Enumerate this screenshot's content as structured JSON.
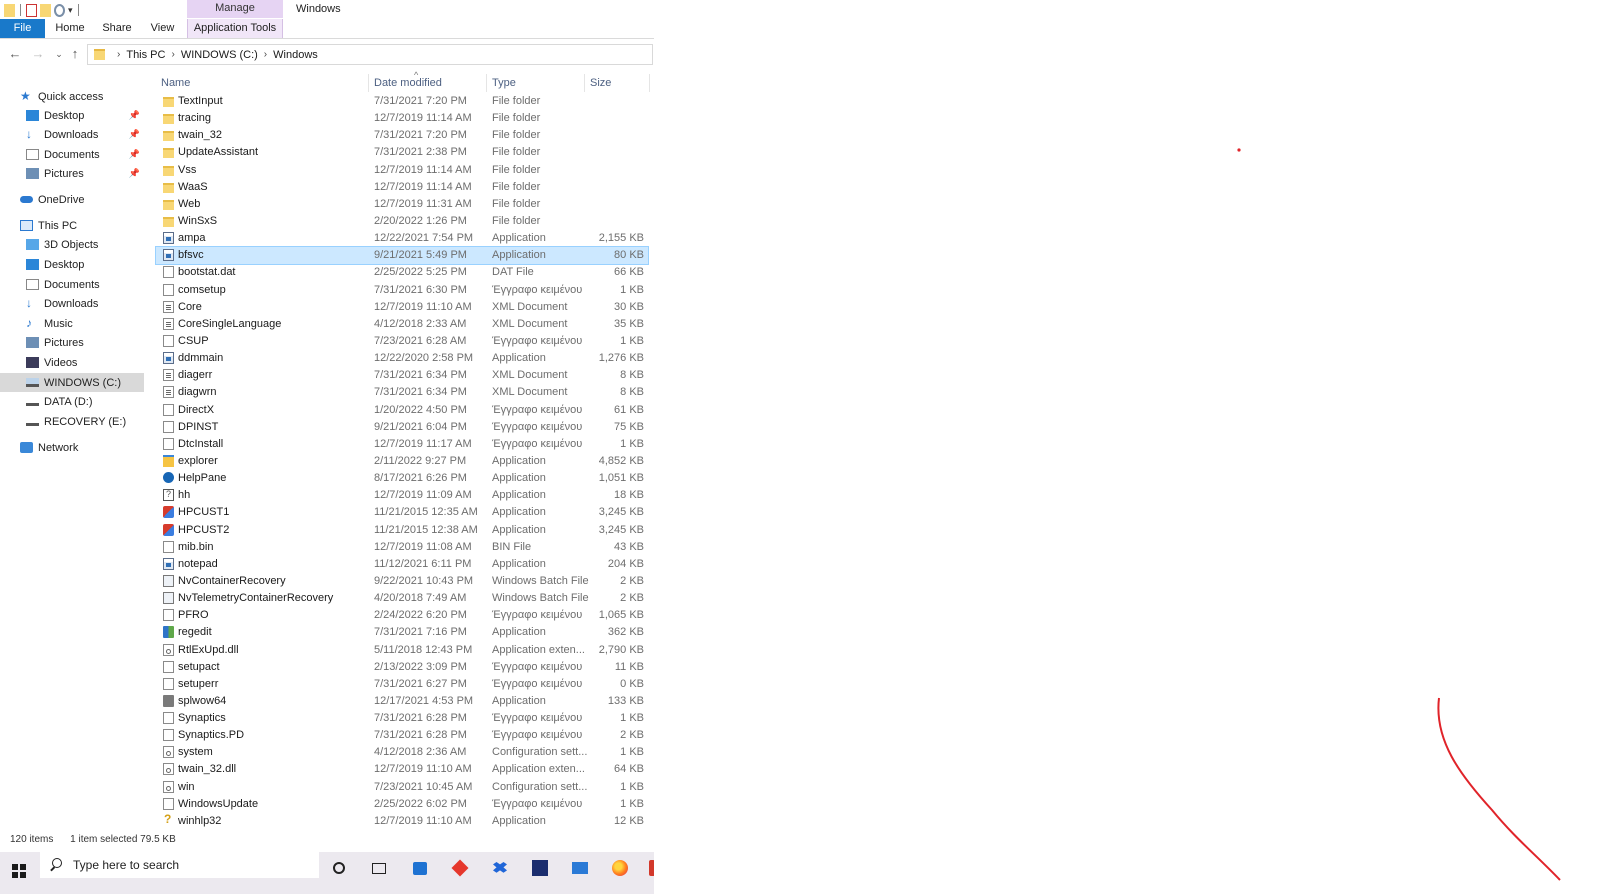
{
  "window": {
    "title": "Windows",
    "manage_tab": "Manage",
    "ribbon_tabs": [
      "File",
      "Home",
      "Share",
      "View",
      "Application Tools"
    ]
  },
  "address": {
    "path": [
      "This PC",
      "WINDOWS (C:)",
      "Windows"
    ]
  },
  "nav": {
    "quick_access": "Quick access",
    "quick_items": [
      "Desktop",
      "Downloads",
      "Documents",
      "Pictures"
    ],
    "onedrive": "OneDrive",
    "this_pc": "This PC",
    "pc_items": [
      "3D Objects",
      "Desktop",
      "Documents",
      "Downloads",
      "Music",
      "Pictures",
      "Videos",
      "WINDOWS (C:)",
      "DATA (D:)",
      "RECOVERY (E:)"
    ],
    "network": "Network"
  },
  "columns": {
    "name": "Name",
    "date": "Date modified",
    "type": "Type",
    "size": "Size"
  },
  "files": [
    {
      "name": "TextInput",
      "date": "7/31/2021 7:20 PM",
      "type": "File folder",
      "size": "",
      "icon": "folder"
    },
    {
      "name": "tracing",
      "date": "12/7/2019 11:14 AM",
      "type": "File folder",
      "size": "",
      "icon": "folder"
    },
    {
      "name": "twain_32",
      "date": "7/31/2021 7:20 PM",
      "type": "File folder",
      "size": "",
      "icon": "folder"
    },
    {
      "name": "UpdateAssistant",
      "date": "7/31/2021 2:38 PM",
      "type": "File folder",
      "size": "",
      "icon": "folder"
    },
    {
      "name": "Vss",
      "date": "12/7/2019 11:14 AM",
      "type": "File folder",
      "size": "",
      "icon": "folder"
    },
    {
      "name": "WaaS",
      "date": "12/7/2019 11:14 AM",
      "type": "File folder",
      "size": "",
      "icon": "folder"
    },
    {
      "name": "Web",
      "date": "12/7/2019 11:31 AM",
      "type": "File folder",
      "size": "",
      "icon": "folder"
    },
    {
      "name": "WinSxS",
      "date": "2/20/2022 1:26 PM",
      "type": "File folder",
      "size": "",
      "icon": "folder"
    },
    {
      "name": "ampa",
      "date": "12/22/2021 7:54 PM",
      "type": "Application",
      "size": "2,155 KB",
      "icon": "app"
    },
    {
      "name": "bfsvc",
      "date": "9/21/2021 5:49 PM",
      "type": "Application",
      "size": "80 KB",
      "icon": "app",
      "selected": true
    },
    {
      "name": "bootstat.dat",
      "date": "2/25/2022 5:25 PM",
      "type": "DAT File",
      "size": "66 KB",
      "icon": "doc"
    },
    {
      "name": "comsetup",
      "date": "7/31/2021 6:30 PM",
      "type": "Έγγραφο κειμένου",
      "size": "1 KB",
      "icon": "doc"
    },
    {
      "name": "Core",
      "date": "12/7/2019 11:10 AM",
      "type": "XML Document",
      "size": "30 KB",
      "icon": "xml"
    },
    {
      "name": "CoreSingleLanguage",
      "date": "4/12/2018 2:33 AM",
      "type": "XML Document",
      "size": "35 KB",
      "icon": "xml"
    },
    {
      "name": "CSUP",
      "date": "7/23/2021 6:28 AM",
      "type": "Έγγραφο κειμένου",
      "size": "1 KB",
      "icon": "doc"
    },
    {
      "name": "ddmmain",
      "date": "12/22/2020 2:58 PM",
      "type": "Application",
      "size": "1,276 KB",
      "icon": "app"
    },
    {
      "name": "diagerr",
      "date": "7/31/2021 6:34 PM",
      "type": "XML Document",
      "size": "8 KB",
      "icon": "xml"
    },
    {
      "name": "diagwrn",
      "date": "7/31/2021 6:34 PM",
      "type": "XML Document",
      "size": "8 KB",
      "icon": "xml"
    },
    {
      "name": "DirectX",
      "date": "1/20/2022 4:50 PM",
      "type": "Έγγραφο κειμένου",
      "size": "61 KB",
      "icon": "doc"
    },
    {
      "name": "DPINST",
      "date": "9/21/2021 6:04 PM",
      "type": "Έγγραφο κειμένου",
      "size": "75 KB",
      "icon": "doc"
    },
    {
      "name": "DtcInstall",
      "date": "12/7/2019 11:17 AM",
      "type": "Έγγραφο κειμένου",
      "size": "1 KB",
      "icon": "doc"
    },
    {
      "name": "explorer",
      "date": "2/11/2022 9:27 PM",
      "type": "Application",
      "size": "4,852 KB",
      "icon": "explorer"
    },
    {
      "name": "HelpPane",
      "date": "8/17/2021 6:26 PM",
      "type": "Application",
      "size": "1,051 KB",
      "icon": "help"
    },
    {
      "name": "hh",
      "date": "12/7/2019 11:09 AM",
      "type": "Application",
      "size": "18 KB",
      "icon": "hh"
    },
    {
      "name": "HPCUST1",
      "date": "11/21/2015 12:35 AM",
      "type": "Application",
      "size": "3,245 KB",
      "icon": "installer"
    },
    {
      "name": "HPCUST2",
      "date": "11/21/2015 12:38 AM",
      "type": "Application",
      "size": "3,245 KB",
      "icon": "installer"
    },
    {
      "name": "mib.bin",
      "date": "12/7/2019 11:08 AM",
      "type": "BIN File",
      "size": "43 KB",
      "icon": "doc"
    },
    {
      "name": "notepad",
      "date": "11/12/2021 6:11 PM",
      "type": "Application",
      "size": "204 KB",
      "icon": "app"
    },
    {
      "name": "NvContainerRecovery",
      "date": "9/22/2021 10:43 PM",
      "type": "Windows Batch File",
      "size": "2 KB",
      "icon": "bat"
    },
    {
      "name": "NvTelemetryContainerRecovery",
      "date": "4/20/2018 7:49 AM",
      "type": "Windows Batch File",
      "size": "2 KB",
      "icon": "bat"
    },
    {
      "name": "PFRO",
      "date": "2/24/2022 6:20 PM",
      "type": "Έγγραφο κειμένου",
      "size": "1,065 KB",
      "icon": "doc"
    },
    {
      "name": "regedit",
      "date": "7/31/2021 7:16 PM",
      "type": "Application",
      "size": "362 KB",
      "icon": "regedit"
    },
    {
      "name": "RtlExUpd.dll",
      "date": "5/11/2018 12:43 PM",
      "type": "Application exten...",
      "size": "2,790 KB",
      "icon": "cfg"
    },
    {
      "name": "setupact",
      "date": "2/13/2022 3:09 PM",
      "type": "Έγγραφο κειμένου",
      "size": "11 KB",
      "icon": "doc"
    },
    {
      "name": "setuperr",
      "date": "7/31/2021 6:27 PM",
      "type": "Έγγραφο κειμένου",
      "size": "0 KB",
      "icon": "doc"
    },
    {
      "name": "splwow64",
      "date": "12/17/2021 4:53 PM",
      "type": "Application",
      "size": "133 KB",
      "icon": "printer"
    },
    {
      "name": "Synaptics",
      "date": "7/31/2021 6:28 PM",
      "type": "Έγγραφο κειμένου",
      "size": "1 KB",
      "icon": "doc"
    },
    {
      "name": "Synaptics.PD",
      "date": "7/31/2021 6:28 PM",
      "type": "Έγγραφο κειμένου",
      "size": "2 KB",
      "icon": "doc"
    },
    {
      "name": "system",
      "date": "4/12/2018 2:36 AM",
      "type": "Configuration sett...",
      "size": "1 KB",
      "icon": "cfg"
    },
    {
      "name": "twain_32.dll",
      "date": "12/7/2019 11:10 AM",
      "type": "Application exten...",
      "size": "64 KB",
      "icon": "cfg"
    },
    {
      "name": "win",
      "date": "7/23/2021 10:45 AM",
      "type": "Configuration sett...",
      "size": "1 KB",
      "icon": "cfg"
    },
    {
      "name": "WindowsUpdate",
      "date": "2/25/2022 6:02 PM",
      "type": "Έγγραφο κειμένου",
      "size": "1 KB",
      "icon": "doc"
    },
    {
      "name": "winhlp32",
      "date": "12/7/2019 11:10 AM",
      "type": "Application",
      "size": "12 KB",
      "icon": "winhlp"
    }
  ],
  "status": {
    "count": "120 items",
    "selection": "1 item selected  79.5 KB"
  },
  "taskbar": {
    "search_placeholder": "Type here to search"
  },
  "annotation": {
    "stroke_color": "#e0242a"
  }
}
